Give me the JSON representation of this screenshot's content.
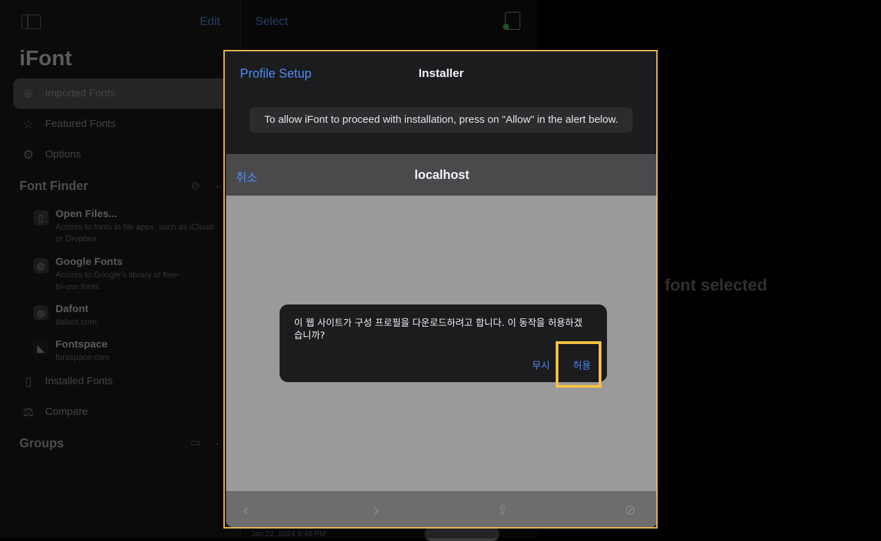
{
  "sidebar": {
    "edit_label": "Edit",
    "app_title": "iFont",
    "nav": [
      {
        "label": "Imported Fonts",
        "icon": "download-circle-icon",
        "selected": true
      },
      {
        "label": "Featured Fonts",
        "icon": "star-icon"
      },
      {
        "label": "Options",
        "icon": "gear-icon"
      }
    ],
    "font_finder": {
      "title": "Font Finder",
      "items": [
        {
          "title": "Open Files...",
          "subtitle": "Access to fonts in file apps, such as iCloud or Dropbox",
          "icon": "open-file-icon"
        },
        {
          "title": "Google Fonts",
          "subtitle": "Access to Google's library of free-to-use fonts",
          "icon": "globe-icon"
        },
        {
          "title": "Dafont",
          "subtitle": "dafont.com",
          "icon": "globe-icon"
        },
        {
          "title": "Fontspace",
          "subtitle": "fontspace.com",
          "icon": "fontspace-logo-icon"
        }
      ]
    },
    "more_nav": [
      {
        "label": "Installed Fonts",
        "icon": "device-icon"
      },
      {
        "label": "Compare",
        "icon": "compare-icon"
      }
    ],
    "groups_title": "Groups"
  },
  "middle": {
    "select_label": "Select",
    "date_text": "Jan 22, 2024 6:48 PM"
  },
  "detail": {
    "empty_text": "font selected"
  },
  "modal": {
    "back_label": "Profile Setup",
    "title": "Installer",
    "notice": "To allow iFont to proceed with installation, press on \"Allow\" in the alert below.",
    "sheet": {
      "cancel_label": "취소",
      "host": "localhost"
    },
    "alert": {
      "message": "이 웹 사이트가 구성 프로필을 다운로드하려고 합니다. 이 동작을 허용하겠습니까?",
      "ignore_label": "무시",
      "allow_label": "허용"
    }
  },
  "colors": {
    "accent": "#4c8df6",
    "highlight": "#f4c243"
  }
}
